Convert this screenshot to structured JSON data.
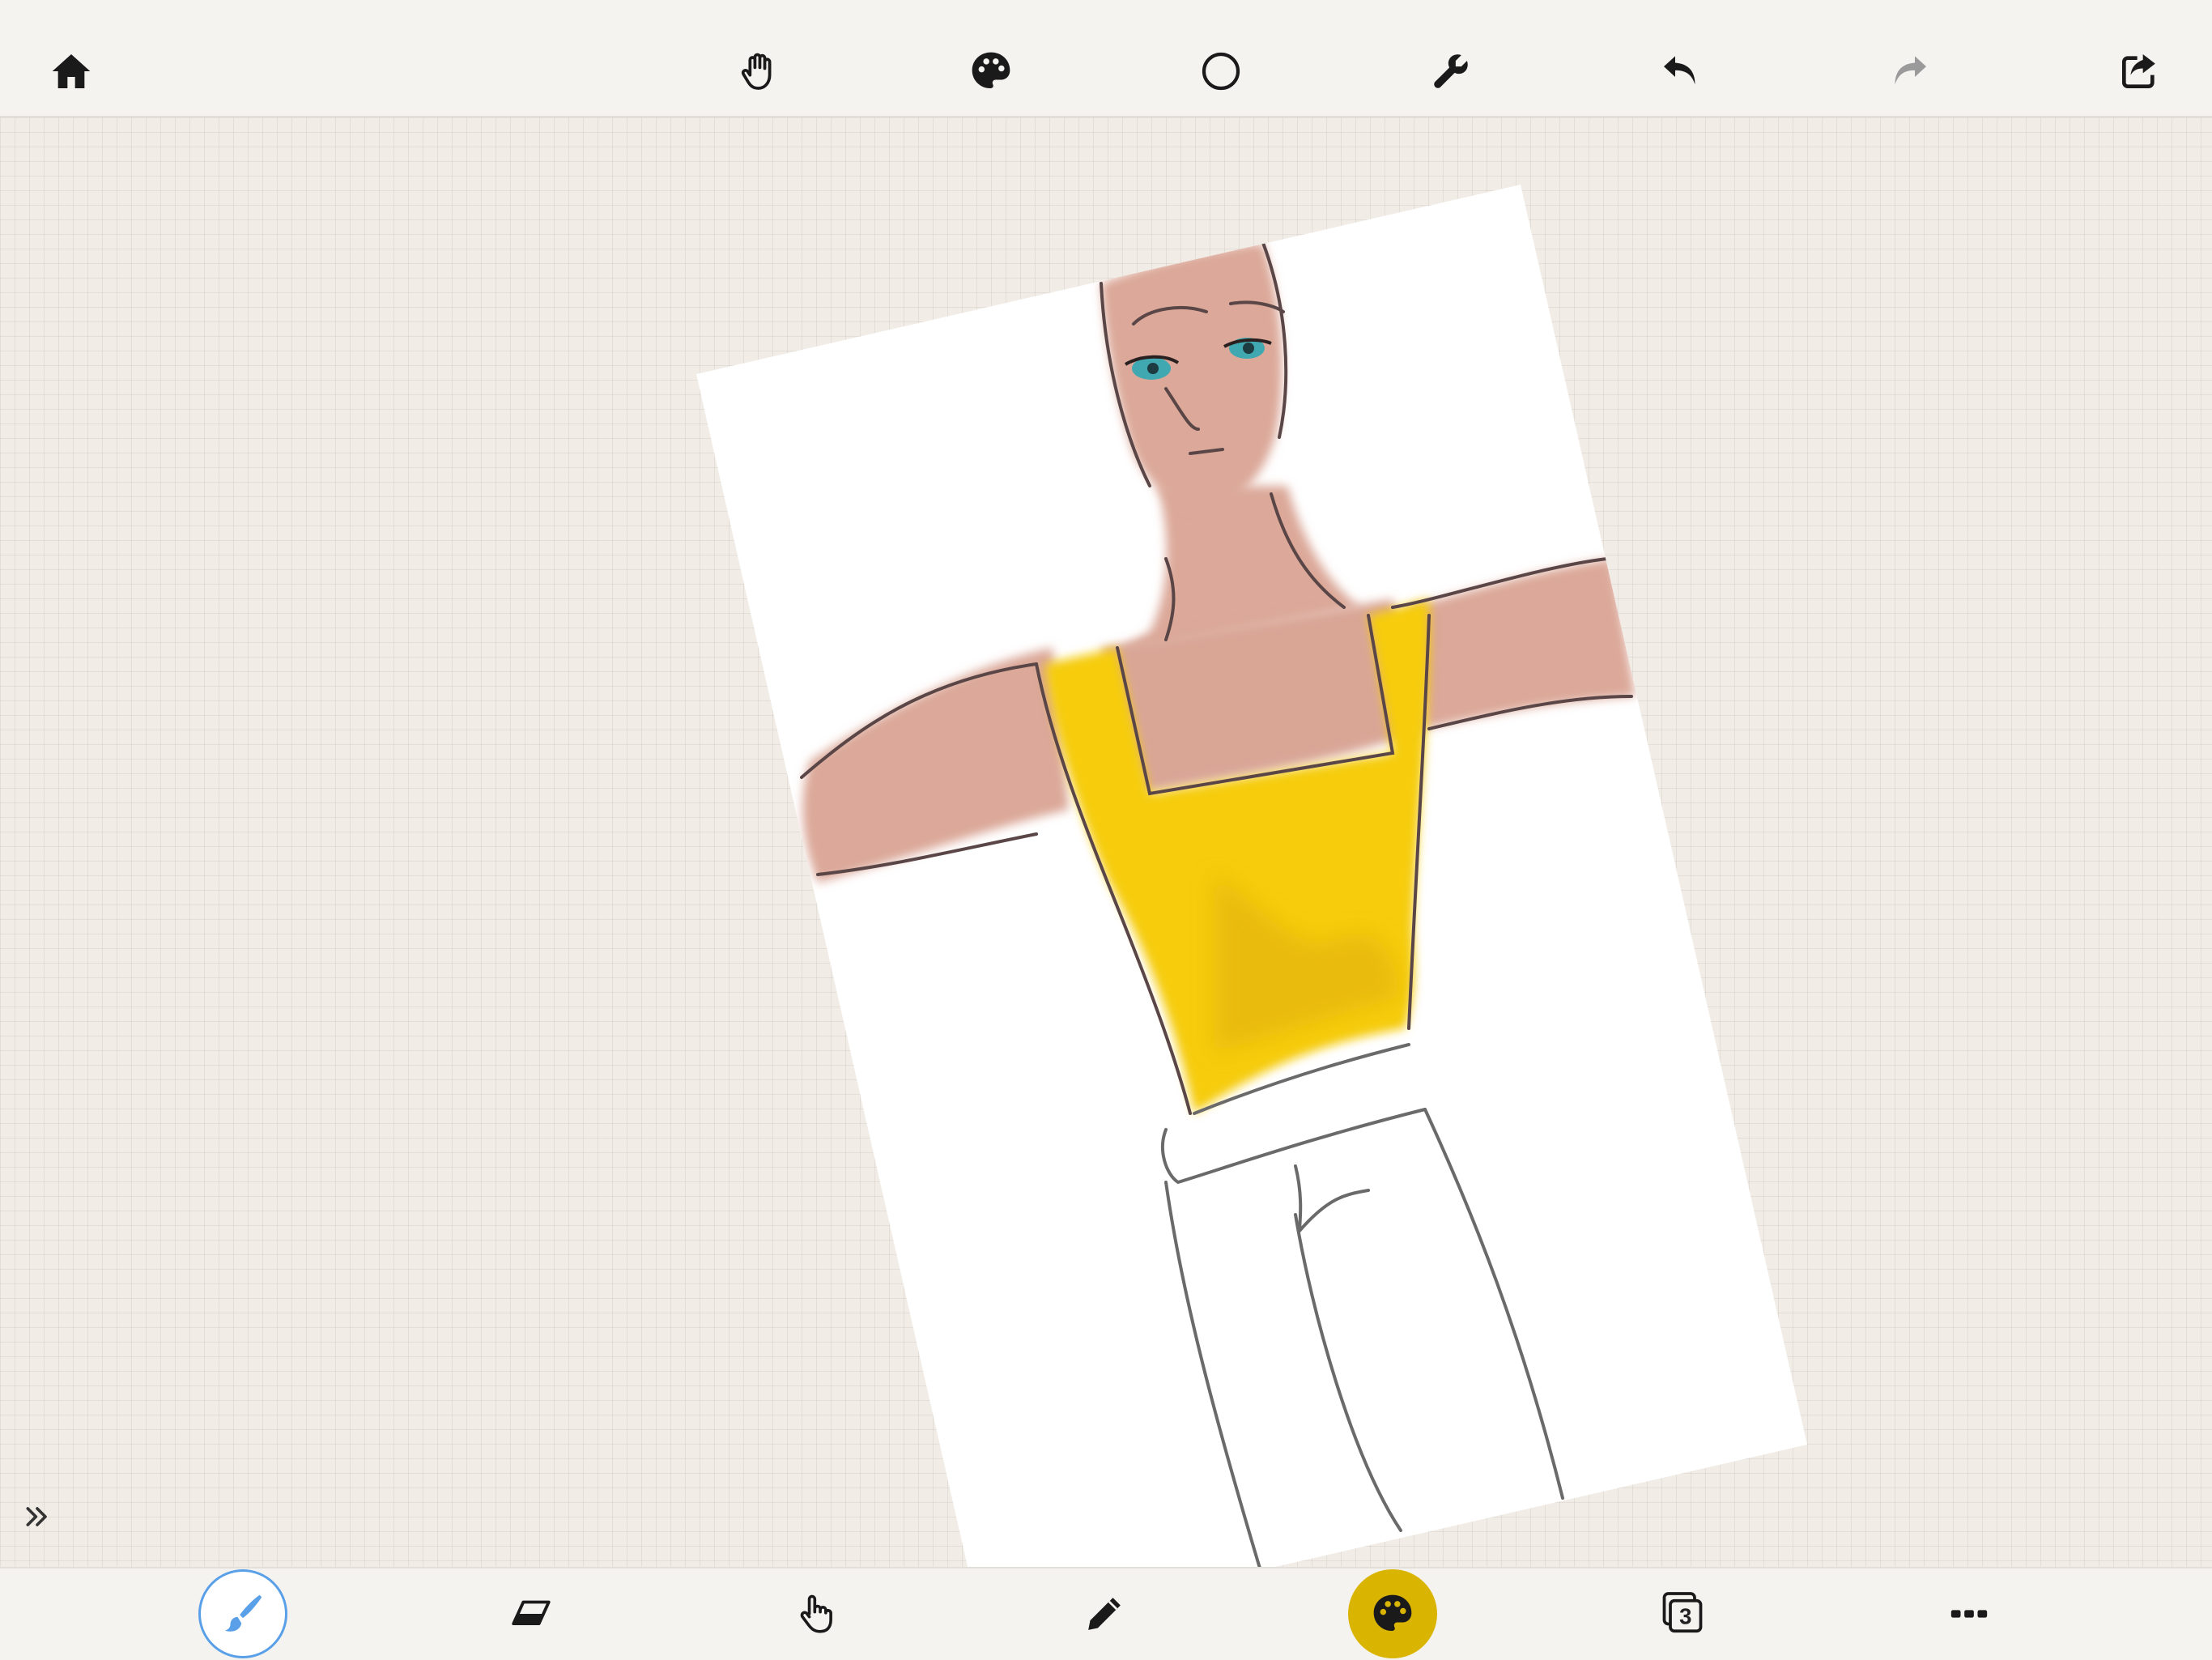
{
  "app": {
    "accent_color": "#5aa0e8",
    "active_color": "#d9b400"
  },
  "top_toolbar": {
    "items": [
      {
        "name": "home",
        "icon": "home-icon"
      },
      {
        "name": "pan",
        "icon": "hand-icon"
      },
      {
        "name": "color",
        "icon": "palette-icon"
      },
      {
        "name": "shape",
        "icon": "circle-icon"
      },
      {
        "name": "settings",
        "icon": "wrench-icon"
      },
      {
        "name": "undo",
        "icon": "undo-icon"
      },
      {
        "name": "redo",
        "icon": "redo-icon",
        "disabled": true
      },
      {
        "name": "share",
        "icon": "share-icon"
      }
    ]
  },
  "bottom_toolbar": {
    "active_tool": "brush",
    "current_color": "#d9b400",
    "layers_count": "3",
    "items": [
      {
        "name": "brush",
        "icon": "brush-icon",
        "active": true
      },
      {
        "name": "eraser",
        "icon": "eraser-icon"
      },
      {
        "name": "smudge",
        "icon": "finger-icon"
      },
      {
        "name": "pencil",
        "icon": "pencil-icon"
      },
      {
        "name": "color-picker",
        "icon": "palette-icon"
      },
      {
        "name": "layers",
        "icon": "layers-icon"
      },
      {
        "name": "more",
        "icon": "more-icon"
      }
    ]
  },
  "sidebar": {
    "toggle_icon": "double-chevron-right-icon"
  },
  "canvas": {
    "paper_color": "#ffffff",
    "skin_color": "#dba899",
    "shirt_color": "#f6cc10",
    "eye_color": "#3fa8b0"
  }
}
